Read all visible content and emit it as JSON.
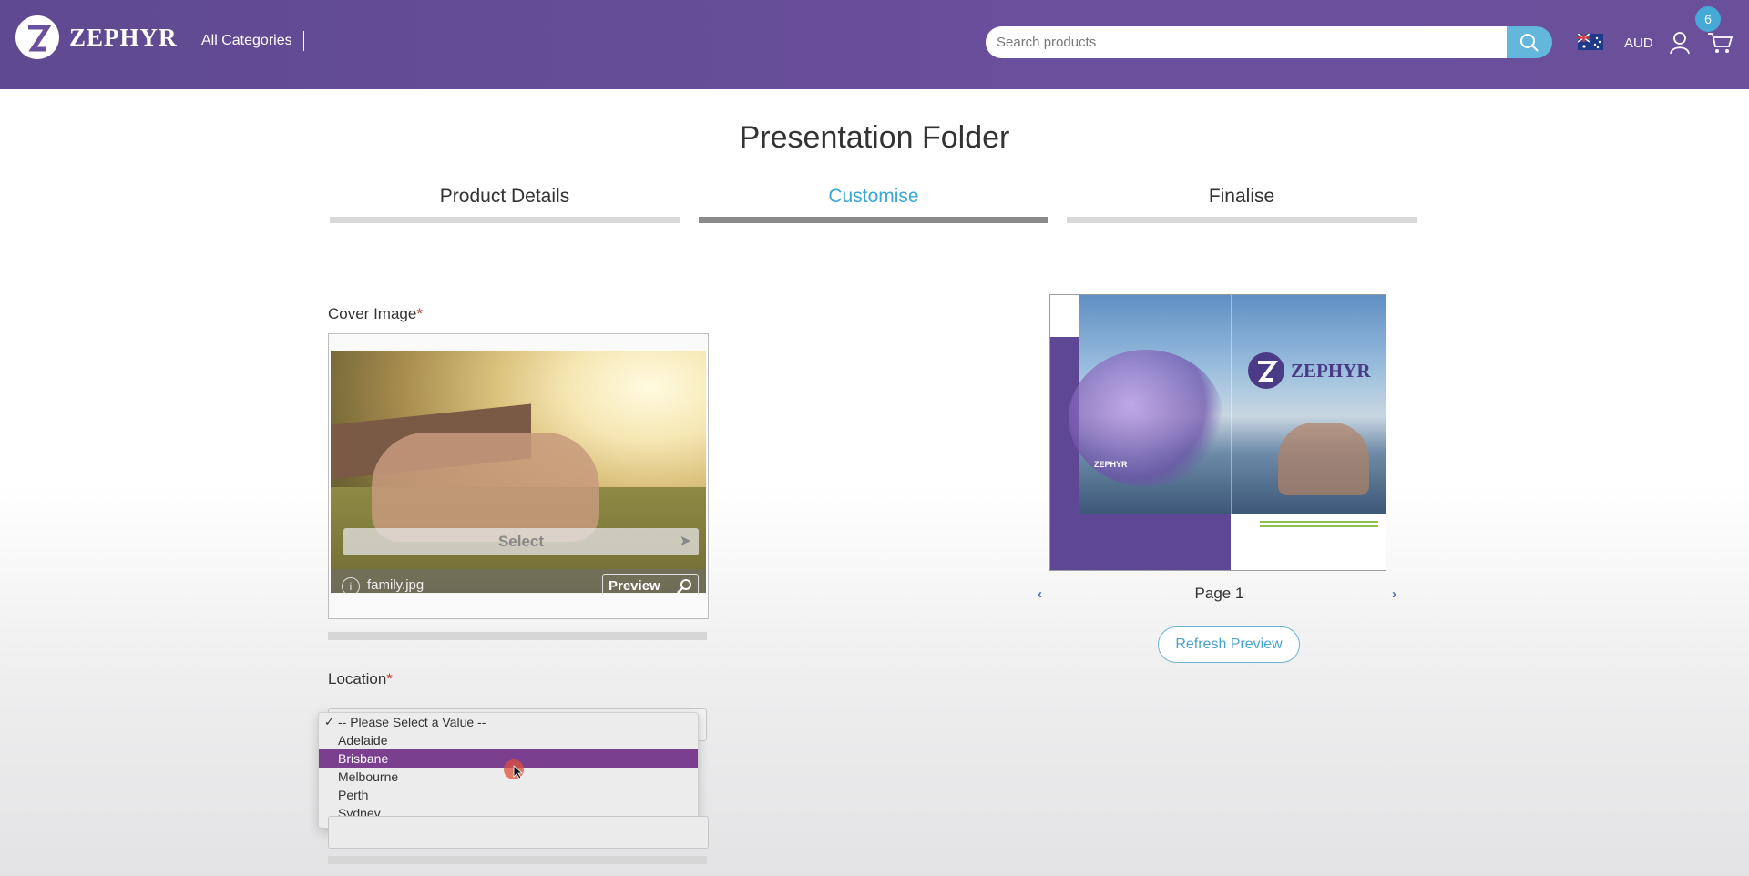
{
  "header": {
    "brand": "ZEPHYR",
    "all_categories": "All Categories",
    "search_placeholder": "Search products",
    "currency": "AUD",
    "cart_count": "6"
  },
  "page": {
    "title": "Presentation Folder"
  },
  "steps": [
    {
      "label": "Product Details",
      "active": false
    },
    {
      "label": "Customise",
      "active": true
    },
    {
      "label": "Finalise",
      "active": false
    }
  ],
  "cover_image": {
    "label": "Cover Image",
    "required_mark": "*",
    "select_label": "Select",
    "filename": "family.jpg",
    "preview_label": "Preview"
  },
  "location": {
    "label": "Location",
    "required_mark": "*",
    "options": [
      "-- Please Select a Value --",
      "Adelaide",
      "Brisbane",
      "Melbourne",
      "Perth",
      "Sydney"
    ],
    "checked": "-- Please Select a Value --",
    "highlighted": "Brisbane"
  },
  "preview": {
    "brand": "ZEPHYR",
    "small_brand": "ZEPHYR",
    "page_label": "Page 1",
    "prev_arrow": "‹",
    "next_arrow": "›",
    "refresh_label": "Refresh Preview"
  },
  "colors": {
    "header": "#6a4f9c",
    "accent": "#3aa6d3",
    "dropdown_highlight": "#7a3f8e"
  }
}
